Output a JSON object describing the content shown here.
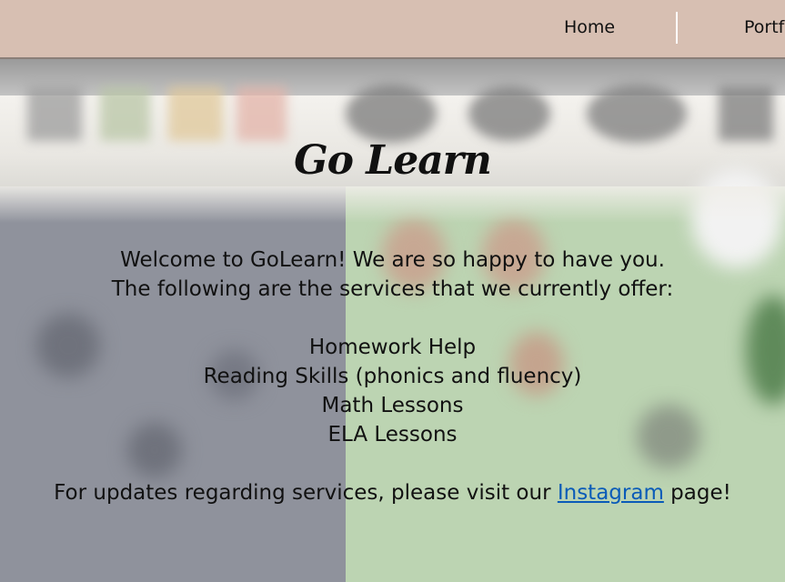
{
  "nav": {
    "items": [
      {
        "label": "Home"
      },
      {
        "label": "Portfo"
      }
    ]
  },
  "main": {
    "title": "Go Learn",
    "welcome": "Welcome to GoLearn! We are so happy to have you.",
    "services_intro": "The following are the services that we currently offer:",
    "services": [
      "Homework Help",
      "Reading Skills (phonics and fluency)",
      "Math Lessons",
      "ELA Lessons"
    ],
    "updates_prefix": "For updates regarding services, please visit our",
    "updates_link": "Instagram",
    "updates_suffix": "page!"
  },
  "colors": {
    "header_bg": "#d7bfb2",
    "link": "#0a5bb8",
    "text": "#111111"
  }
}
